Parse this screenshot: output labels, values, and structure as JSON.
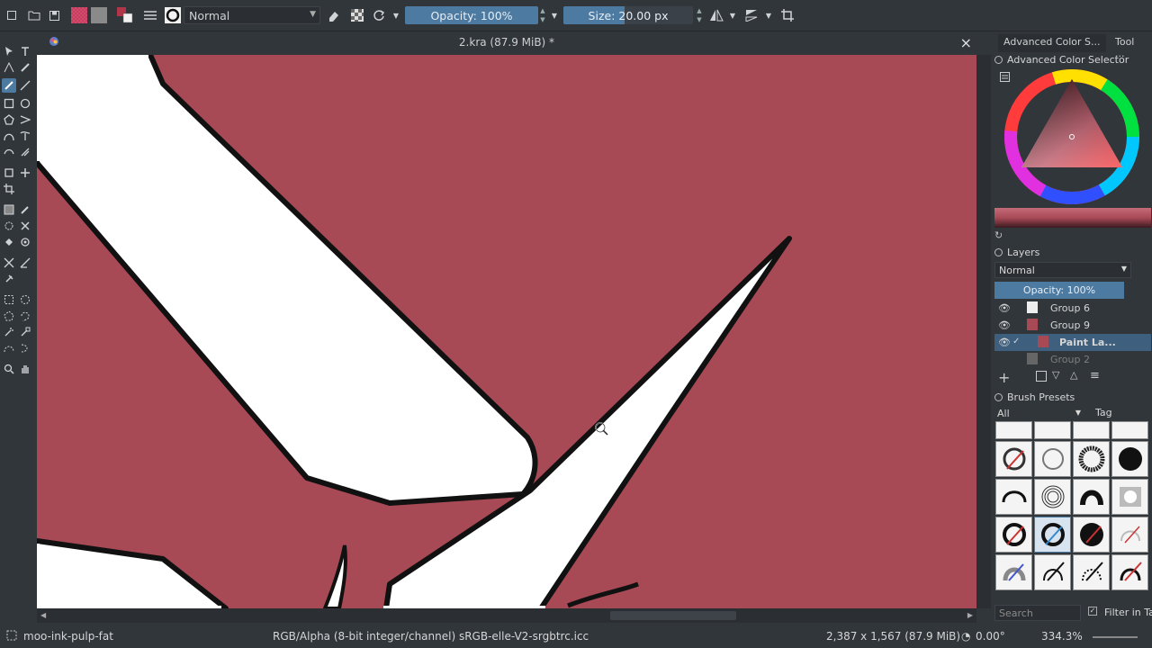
{
  "toolbar": {
    "blend_mode": "Normal",
    "opacity": "Opacity: 100%",
    "size": "Size: 20.00 px"
  },
  "document": {
    "title": "2.kra (87.9 MiB) *",
    "close_glyph": "×"
  },
  "docker": {
    "tabs": [
      "Advanced Color S...",
      "Tool ..."
    ],
    "color_selector_title": "Advanced Color Selector",
    "layers_title": "Layers",
    "layers_blend_mode": "Normal",
    "layers_opacity": "Opacity:  100%",
    "layers": [
      {
        "name": "Group 6"
      },
      {
        "name": "Group 9"
      },
      {
        "name": "Paint La..."
      },
      {
        "name": "Group 2"
      }
    ],
    "brush_presets_title": "Brush Presets",
    "brush_filter": "All",
    "tag_label": "Tag",
    "search_placeholder": "Search",
    "filter_in_tag": "Filter in Tag"
  },
  "status": {
    "brush_name": "moo-ink-pulp-fat",
    "color_space": "RGB/Alpha (8-bit integer/channel)  sRGB-elle-V2-srgbtrc.icc",
    "image_size": "2,387 x 1,567 (87.9 MiB)",
    "rotation": "0.00°",
    "zoom": "334.3%"
  },
  "colors": {
    "canvas": "#a84a56",
    "accent": "#4d7aa0",
    "ui_bg": "#31363b"
  }
}
